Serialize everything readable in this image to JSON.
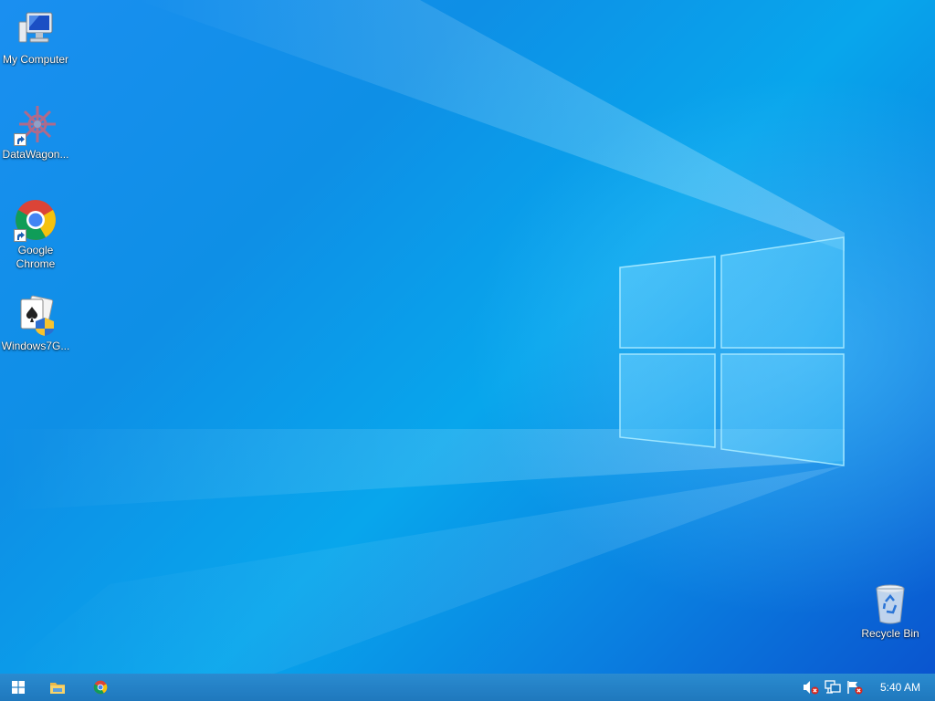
{
  "desktop": {
    "icons": [
      {
        "label": "My Computer",
        "icon": "computer-icon"
      },
      {
        "label": "DataWagon...",
        "icon": "datawagon-icon"
      },
      {
        "label": "Google\nChrome",
        "icon": "chrome-icon"
      },
      {
        "label": "Windows7G...",
        "icon": "solitaire-icon"
      },
      {
        "label": "Recycle Bin",
        "icon": "recycle-bin-icon"
      }
    ]
  },
  "taskbar": {
    "start_icon": "windows-logo-icon",
    "pinned": [
      "file-explorer-icon",
      "chrome-icon"
    ],
    "tray": [
      "volume-muted-icon",
      "network-icon",
      "action-center-icon"
    ],
    "clock": "5:40 AM"
  },
  "colors": {
    "accent": "#0a78d7",
    "taskbar": "#1f78bd"
  }
}
